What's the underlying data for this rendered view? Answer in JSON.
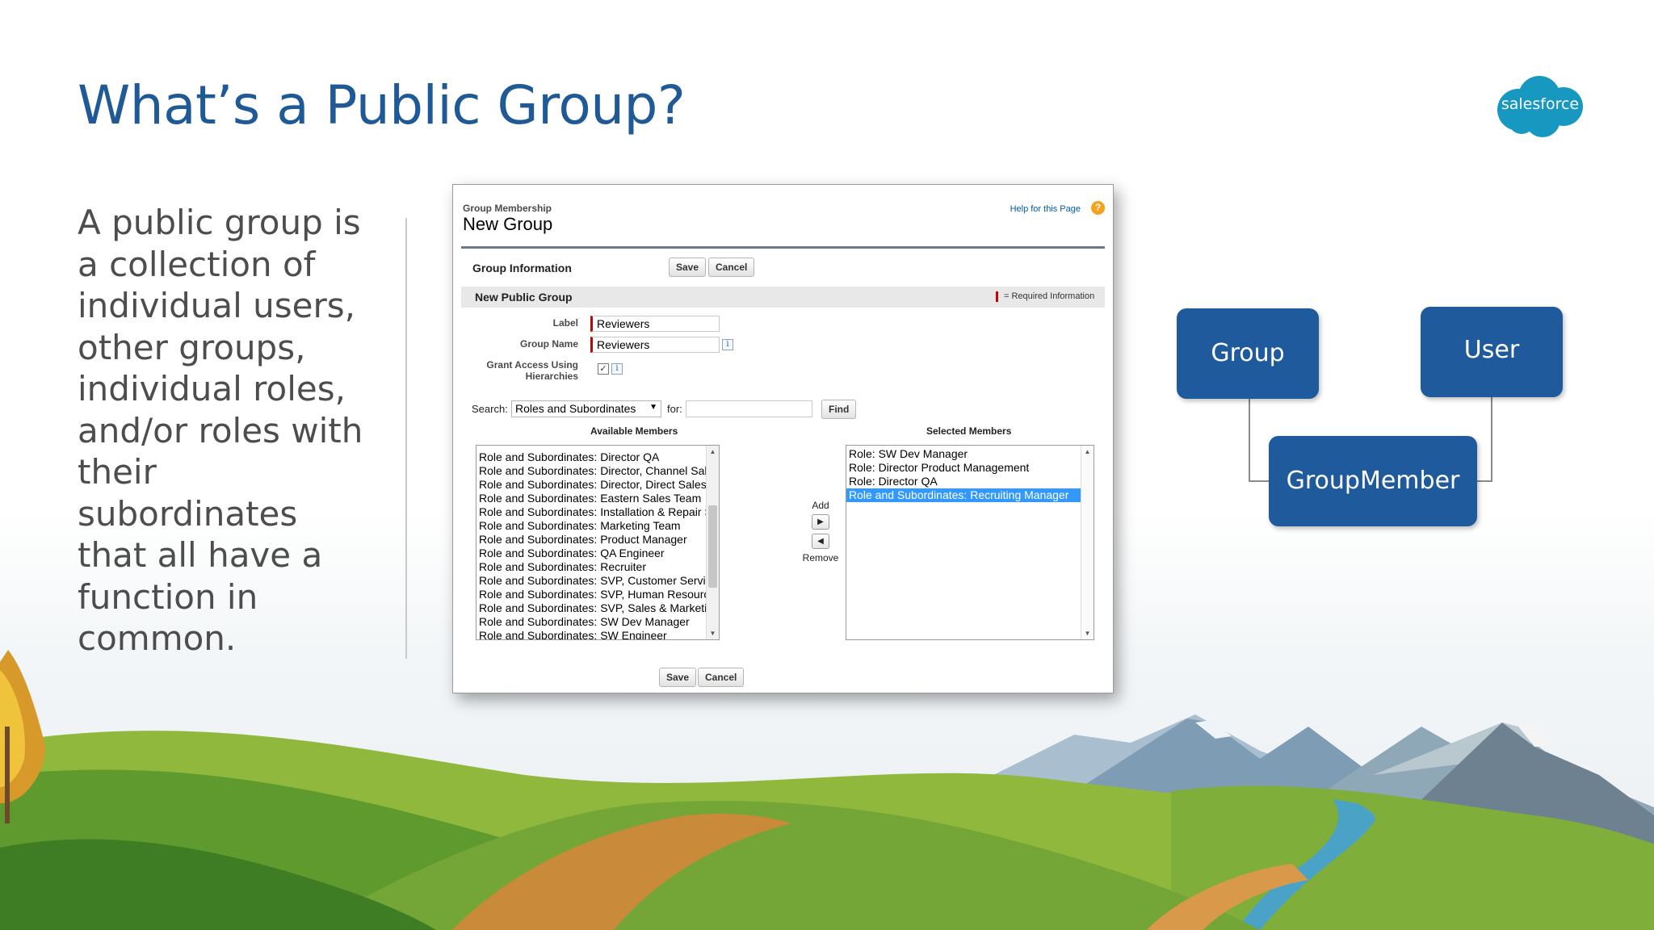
{
  "slide": {
    "title": "What’s a Public Group?",
    "body": "A public group is a collection of individual users, other groups, individual roles, and/or roles with their subordinates that all have a function in common.",
    "logo_text": "salesforce",
    "colors": {
      "title": "#1f5a96",
      "brand": "#1798c1",
      "entity_box": "#1f5a9c"
    }
  },
  "window": {
    "breadcrumb": "Group Membership",
    "heading": "New Group",
    "help_link": "Help for this Page",
    "help_icon": "question-icon",
    "group_info": {
      "title": "Group Information",
      "save_label": "Save",
      "cancel_label": "Cancel"
    },
    "subsection": {
      "title": "New Public Group",
      "required_text": "= Required Information"
    },
    "form": {
      "label_label": "Label",
      "label_value": "Reviewers",
      "group_name_label": "Group Name",
      "group_name_value": "Reviewers",
      "grant_access_label_1": "Grant Access Using",
      "grant_access_label_2": "Hierarchies",
      "grant_access_checked": true,
      "info_icon_text": "i"
    },
    "search": {
      "label": "Search:",
      "selected": "Roles and Subordinates",
      "for_label": "for:",
      "for_value": "",
      "find_label": "Find"
    },
    "available": {
      "header": "Available Members",
      "items": [
        "Role and Subordinates: Director QA",
        "Role and Subordinates: Director, Channel Sales",
        "Role and Subordinates: Director, Direct Sales",
        "Role and Subordinates: Eastern Sales Team",
        "Role and Subordinates: Installation & Repair Services",
        "Role and Subordinates: Marketing Team",
        "Role and Subordinates: Product Manager",
        "Role and Subordinates: QA Engineer",
        "Role and Subordinates: Recruiter",
        "Role and Subordinates: SVP, Customer Service & Support",
        "Role and Subordinates: SVP, Human Resources",
        "Role and Subordinates: SVP, Sales & Marketing",
        "Role and Subordinates: SW Dev Manager",
        "Role and Subordinates: SW Engineer"
      ]
    },
    "mover": {
      "add_label": "Add",
      "remove_label": "Remove"
    },
    "selected_members": {
      "header": "Selected Members",
      "items": [
        "Role: SW Dev Manager",
        "Role: Director Product Management",
        "Role: Director QA",
        "Role and Subordinates: Recruiting Manager"
      ],
      "highlighted_index": 3
    },
    "footer": {
      "save_label": "Save",
      "cancel_label": "Cancel"
    }
  },
  "diagram": {
    "group_label": "Group",
    "user_label": "User",
    "member_label": "GroupMember"
  }
}
